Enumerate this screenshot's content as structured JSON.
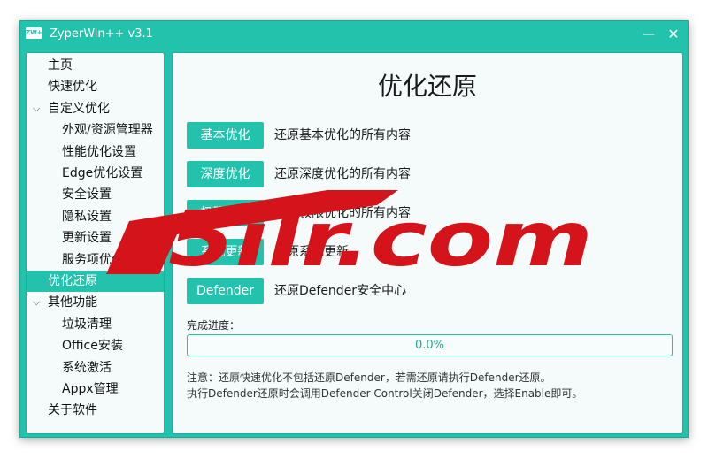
{
  "window": {
    "title": "ZyperWin++ v3.1",
    "icon_text": "ZW+",
    "minimize_glyph": "—",
    "close_glyph": "✕"
  },
  "sidebar": {
    "items": [
      {
        "label": "主页",
        "level": 0
      },
      {
        "label": "快速优化",
        "level": 0
      },
      {
        "label": "自定义优化",
        "level": 0,
        "expanded": true
      },
      {
        "label": "外观/资源管理器",
        "level": 1
      },
      {
        "label": "性能优化设置",
        "level": 1
      },
      {
        "label": "Edge优化设置",
        "level": 1
      },
      {
        "label": "安全设置",
        "level": 1
      },
      {
        "label": "隐私设置",
        "level": 1
      },
      {
        "label": "更新设置",
        "level": 1
      },
      {
        "label": "服务项优化",
        "level": 1
      },
      {
        "label": "优化还原",
        "level": 0,
        "selected": true
      },
      {
        "label": "其他功能",
        "level": 0,
        "expanded": true
      },
      {
        "label": "垃圾清理",
        "level": 1
      },
      {
        "label": "Office安装",
        "level": 1
      },
      {
        "label": "系统激活",
        "level": 1
      },
      {
        "label": "Appx管理",
        "level": 1
      },
      {
        "label": "关于软件",
        "level": 0
      }
    ]
  },
  "main": {
    "title": "优化还原",
    "options": [
      {
        "button": "基本优化",
        "desc": "还原基本优化的所有内容"
      },
      {
        "button": "深度优化",
        "desc": "还原深度优化的所有内容"
      },
      {
        "button": "极限优化",
        "desc": "还原极限优化的所有内容"
      },
      {
        "button": "系统更新",
        "desc": "还原系统更新"
      },
      {
        "button": "Defender",
        "desc": "还原Defender安全中心"
      }
    ],
    "progress": {
      "label": "完成进度：",
      "value": 0.0,
      "text": "0.0%"
    },
    "notes": [
      "注意：还原快速优化不包括还原Defender，若需还原请执行Defender还原。",
      "执行Defender还原时会调用Defender Control关闭Defender，选择Enable即可。"
    ]
  },
  "watermark": {
    "text": "5ilr.com"
  },
  "colors": {
    "accent": "#22c2ad",
    "panel": "#f4fbfa",
    "watermark": "#d4141a"
  }
}
